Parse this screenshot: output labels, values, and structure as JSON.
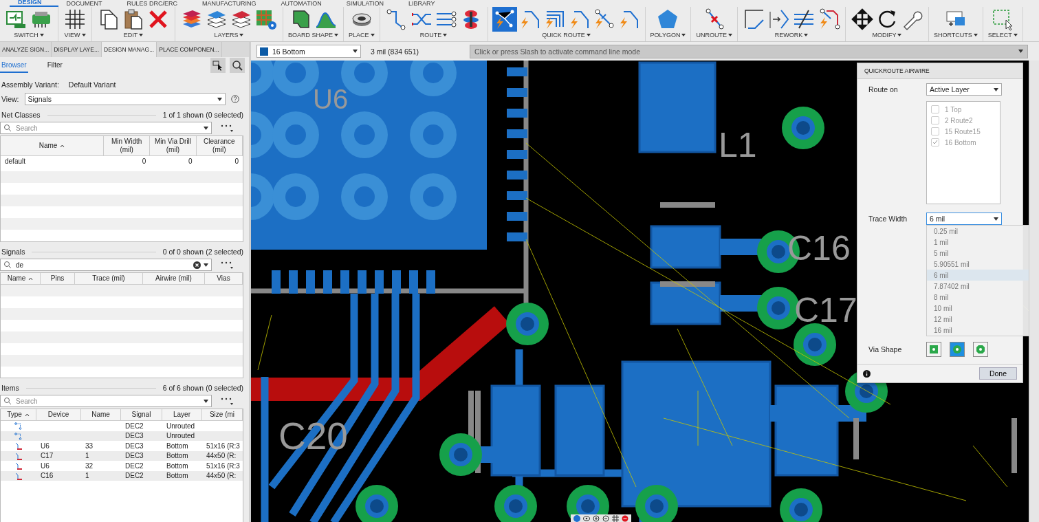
{
  "ribbon_tabs": [
    {
      "label": "DESIGN",
      "selected": true
    },
    {
      "label": "DOCUMENT",
      "selected": false
    },
    {
      "label": "RULES DRC/ERC",
      "selected": false
    },
    {
      "label": "MANUFACTURING",
      "selected": false
    },
    {
      "label": "AUTOMATION",
      "selected": false
    },
    {
      "label": "SIMULATION",
      "selected": false
    },
    {
      "label": "LIBRARY",
      "selected": false
    }
  ],
  "toolbar_groups": [
    {
      "label": "SWITCH",
      "tools": [
        {
          "kind": "schematic",
          "selected": false
        },
        {
          "kind": "board",
          "selected": false
        }
      ]
    },
    {
      "label": "VIEW",
      "tools": [
        {
          "kind": "grid",
          "selected": false
        }
      ]
    },
    {
      "label": "EDIT",
      "tools": [
        {
          "kind": "copy",
          "selected": false
        },
        {
          "kind": "paste",
          "selected": false
        },
        {
          "kind": "delete",
          "selected": false
        }
      ]
    },
    {
      "label": "LAYERS",
      "tools": [
        {
          "kind": "layers_color",
          "selected": false
        },
        {
          "kind": "layers_blue",
          "selected": false
        },
        {
          "kind": "layers_red",
          "selected": false
        },
        {
          "kind": "layer_settings",
          "selected": false
        }
      ]
    },
    {
      "label": "BOARD SHAPE",
      "tools": [
        {
          "kind": "outline",
          "selected": false
        },
        {
          "kind": "curve",
          "selected": false
        }
      ]
    },
    {
      "label": "PLACE",
      "tools": [
        {
          "kind": "via",
          "selected": false
        }
      ]
    },
    {
      "label": "ROUTE",
      "tools": [
        {
          "kind": "route",
          "selected": false
        },
        {
          "kind": "diff",
          "selected": false
        },
        {
          "kind": "multi",
          "selected": false
        },
        {
          "kind": "stack",
          "selected": false
        }
      ]
    },
    {
      "label": "QUICK ROUTE",
      "tools": [
        {
          "kind": "airwire",
          "selected": true
        },
        {
          "kind": "quick",
          "selected": false
        },
        {
          "kind": "bus",
          "selected": false
        },
        {
          "kind": "quick",
          "selected": false
        },
        {
          "kind": "quick_via",
          "selected": false
        },
        {
          "kind": "quick",
          "selected": false
        }
      ]
    },
    {
      "label": "POLYGON",
      "tools": [
        {
          "kind": "polygon",
          "selected": false
        }
      ]
    },
    {
      "label": "UNROUTE",
      "tools": [
        {
          "kind": "unroute",
          "selected": false
        }
      ]
    },
    {
      "label": "REWORK",
      "tools": [
        {
          "kind": "corner",
          "selected": false
        },
        {
          "kind": "arrow",
          "selected": false
        },
        {
          "kind": "lines",
          "selected": false
        },
        {
          "kind": "rework",
          "selected": false
        }
      ]
    },
    {
      "label": "MODIFY",
      "tools": [
        {
          "kind": "move",
          "selected": false
        },
        {
          "kind": "rotate",
          "selected": false
        },
        {
          "kind": "wrench",
          "selected": false
        }
      ]
    },
    {
      "label": "SHORTCUTS",
      "tools": [
        {
          "kind": "shortcut",
          "selected": false
        }
      ]
    },
    {
      "label": "SELECT",
      "tools": [
        {
          "kind": "select",
          "selected": false
        }
      ]
    }
  ],
  "panel_tabs": [
    {
      "label": "ANALYZE SIGN...",
      "selected": false
    },
    {
      "label": "DISPLAY LAYE...",
      "selected": false
    },
    {
      "label": "DESIGN MANAG...",
      "selected": true
    },
    {
      "label": "PLACE COMPONEN...",
      "selected": false
    }
  ],
  "sub_tabs": [
    {
      "label": "Browser",
      "selected": true
    },
    {
      "label": "Filter",
      "selected": false
    }
  ],
  "assembly_variant": {
    "label": "Assembly Variant:",
    "value": "Default Variant"
  },
  "view": {
    "label": "View:",
    "value": "Signals"
  },
  "net_classes": {
    "title": "Net Classes",
    "count": "1 of 1 shown (0 selected)",
    "search": {
      "placeholder": "Search"
    },
    "columns": [
      "Name",
      "Min Width\n(mil)",
      "Min Via Drill\n(mil)",
      "Clearance\n(mil)"
    ],
    "rows": [
      [
        "default",
        "0",
        "0",
        "0"
      ]
    ]
  },
  "signals": {
    "title": "Signals",
    "count": "0 of 0 shown (2 selected)",
    "search": {
      "value": "de"
    },
    "columns": [
      "Name",
      "Pins",
      "Trace (mil)",
      "Airwire (mil)",
      "Vias"
    ]
  },
  "items": {
    "title": "Items",
    "count": "6 of 6 shown (0 selected)",
    "search": {
      "placeholder": "Search"
    },
    "columns": [
      "Type",
      "Device",
      "Name",
      "Signal",
      "Layer",
      "Size (mi"
    ],
    "rows": [
      {
        "kind": "airwire",
        "device": "",
        "name": "",
        "signal": "DEC2",
        "layer": "Unrouted",
        "size": ""
      },
      {
        "kind": "airwire",
        "device": "",
        "name": "",
        "signal": "DEC3",
        "layer": "Unrouted",
        "size": ""
      },
      {
        "kind": "pad",
        "device": "U6",
        "name": "33",
        "signal": "DEC3",
        "layer": "Bottom",
        "size": "51x16 (R:3"
      },
      {
        "kind": "pad",
        "device": "C17",
        "name": "1",
        "signal": "DEC3",
        "layer": "Bottom",
        "size": "44x50 (R:"
      },
      {
        "kind": "pad",
        "device": "U6",
        "name": "32",
        "signal": "DEC2",
        "layer": "Bottom",
        "size": "51x16 (R:3"
      },
      {
        "kind": "pad",
        "device": "C16",
        "name": "1",
        "signal": "DEC2",
        "layer": "Bottom",
        "size": "44x50 (R:"
      }
    ]
  },
  "layer_select": {
    "value": "16 Bottom",
    "color": "#0b5aa6"
  },
  "coordinates": "3 mil (834 651)",
  "command_line": {
    "placeholder": "Click or press Slash to activate command line mode"
  },
  "silkscreen_labels": [
    "U6",
    "L1",
    "C16",
    "C17",
    "C20"
  ],
  "quickroute_panel": {
    "title": "QUICKROUTE AIRWIRE",
    "route_on": {
      "label": "Route on",
      "value": "Active Layer"
    },
    "layers": [
      {
        "label": "1 Top",
        "checked": false
      },
      {
        "label": "2 Route2",
        "checked": false
      },
      {
        "label": "15 Route15",
        "checked": false
      },
      {
        "label": "16 Bottom",
        "checked": true
      }
    ],
    "trace_width": {
      "label": "Trace Width",
      "value": "6 mil",
      "options": [
        {
          "label": "0.25 mil",
          "selected": false
        },
        {
          "label": "1 mil",
          "selected": false
        },
        {
          "label": "5 mil",
          "selected": false
        },
        {
          "label": "5.90551 mil",
          "selected": false
        },
        {
          "label": "6 mil",
          "selected": true
        },
        {
          "label": "7.87402 mil",
          "selected": false
        },
        {
          "label": "8 mil",
          "selected": false
        },
        {
          "label": "10 mil",
          "selected": false
        },
        {
          "label": "12 mil",
          "selected": false
        },
        {
          "label": "16 mil",
          "selected": false
        }
      ]
    },
    "via_shape": {
      "label": "Via Shape",
      "shapes": [
        {
          "kind": "square",
          "selected": false
        },
        {
          "kind": "round",
          "selected": true
        },
        {
          "kind": "octagon",
          "selected": false
        }
      ]
    },
    "done": "Done"
  }
}
